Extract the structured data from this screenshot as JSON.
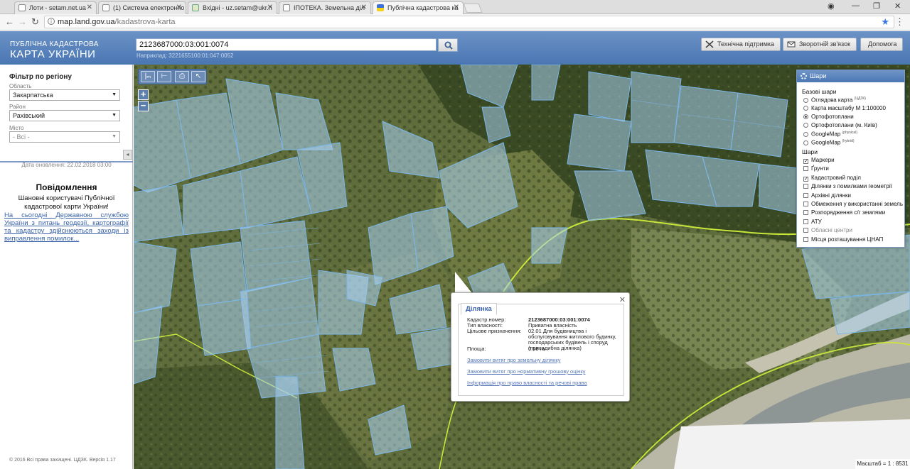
{
  "browser": {
    "tabs": [
      {
        "label": "Лоти - setam.net.ua"
      },
      {
        "label": "(1) Система електронно"
      },
      {
        "label": "Вхідні - uz.setam@ukr.n"
      },
      {
        "label": "ІПОТЕКА. Земельна діл"
      },
      {
        "label": "Публічна кадастрова ка"
      }
    ],
    "url_host": "map.land.gov.ua",
    "url_path": "/kadastrova-karta"
  },
  "header": {
    "logo_line1": "ПУБЛІЧНА КАДАСТРОВА",
    "logo_line2": "КАРТА УКРАЇНИ",
    "search_value": "2123687000:03:001:0074",
    "search_hint": "Наприклад: 3221655100:01:047:0052",
    "support_label": "Технічна підтримка",
    "feedback_label": "Зворотній зв'язок",
    "help_label": "Допомога"
  },
  "filter": {
    "title": "Фільтр по регіону",
    "region_label": "Область",
    "region_value": "Закарпатська",
    "district_label": "Район",
    "district_value": "Рахівський",
    "city_label": "Місто",
    "city_value": "- Всі -"
  },
  "sidebar": {
    "updated": "Дата оновлення: 22.02.2018 03:00",
    "notice_title": "Повідомлення",
    "notice_text": "Шановні користувачі Публічної кадастрової карти України!",
    "notice_link": "На сьогодні Державною службою України з питань геодезії, картографії та кадастру здійснюються заходи із виправлення помилок...",
    "copyright": "© 2016 Всі права захищені. ЦДЗК. Версія 1.17"
  },
  "layers": {
    "title": "Шари",
    "base_title": "Базові шари",
    "base": [
      {
        "label": "Оглядова карта",
        "sup": "(ЦДЗК)",
        "checked": false
      },
      {
        "label": "Карта масштабу М 1:100000",
        "sup": "",
        "checked": false
      },
      {
        "label": "Ортофотоплани",
        "sup": "",
        "checked": true
      },
      {
        "label": "Ортофотоплани (м. Київ)",
        "sup": "",
        "checked": false
      },
      {
        "label": "GoogleMap",
        "sup": "(physical)",
        "checked": false
      },
      {
        "label": "GoogleMap",
        "sup": "(hybrid)",
        "checked": false
      }
    ],
    "overlays_title": "Шари",
    "overlays": [
      {
        "label": "Маркери",
        "checked": true,
        "dim": false
      },
      {
        "label": "Ґрунти",
        "checked": false,
        "dim": false
      },
      {
        "label": "Кадастровий поділ",
        "checked": true,
        "dim": false
      },
      {
        "label": "Ділянки з помилками геометрії",
        "checked": false,
        "dim": false
      },
      {
        "label": "Архівні ділянки",
        "checked": false,
        "dim": false
      },
      {
        "label": "Обмеження у використанні земель",
        "checked": false,
        "dim": false
      },
      {
        "label": "Розпорядження с/г землями",
        "checked": false,
        "dim": false
      },
      {
        "label": "АТУ",
        "checked": false,
        "dim": false
      },
      {
        "label": "Обласні центри",
        "checked": false,
        "dim": true
      },
      {
        "label": "Місця розташування ЦНАП",
        "checked": false,
        "dim": false
      }
    ]
  },
  "popup": {
    "tab": "Ділянка",
    "rows": [
      {
        "k": "Кадастр.номер:",
        "v": "2123687000:03:001:0074"
      },
      {
        "k": "Тип власності:",
        "v": "Приватна власність"
      },
      {
        "k": "Цільове призначення:",
        "v": "02.01 Для будівництва і обслуговування житлового будинку, господарських будівель і споруд (присадибна ділянка)"
      },
      {
        "k": "Площа:",
        "v": "0.58 га"
      }
    ],
    "links": [
      "Замовити витяг про земельну ділянку",
      "Замовити витяг про нормативну грошову оцінку",
      "Інформація про право власності та речові права"
    ]
  },
  "scale": "Масштаб = 1 : 8531",
  "colors": {
    "header": "#4a76b3",
    "parcel": "#a8cff0",
    "boundary": "#c8e63a"
  }
}
